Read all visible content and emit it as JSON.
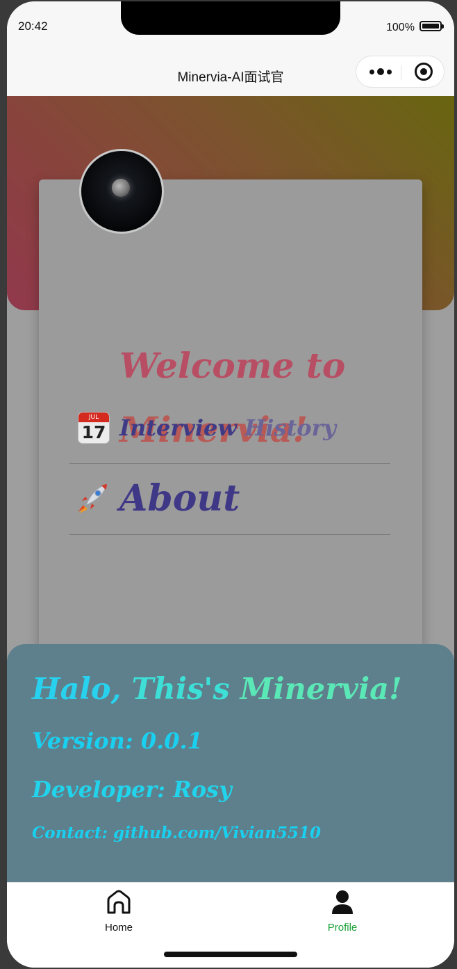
{
  "status": {
    "time": "20:42",
    "battery": "100%"
  },
  "nav": {
    "title": "Minervia-AI面试官"
  },
  "profile": {
    "welcome_line1": "Welcome to",
    "welcome_line2": "Minervia!",
    "menu": {
      "history_word1": "Interview",
      "history_word2": "History",
      "calendar_month": "JUL",
      "calendar_day": "17",
      "about": "About"
    }
  },
  "about_panel": {
    "title_part1": "Halo,",
    "title_part2": "This's",
    "title_part3": "Minervia!",
    "version": "Version: 0.0.1",
    "developer": "Developer: Rosy",
    "contact": "Contact: github.com/Vivian5510"
  },
  "tabbar": {
    "home": "Home",
    "profile": "Profile",
    "active_color": "#1aa036"
  }
}
